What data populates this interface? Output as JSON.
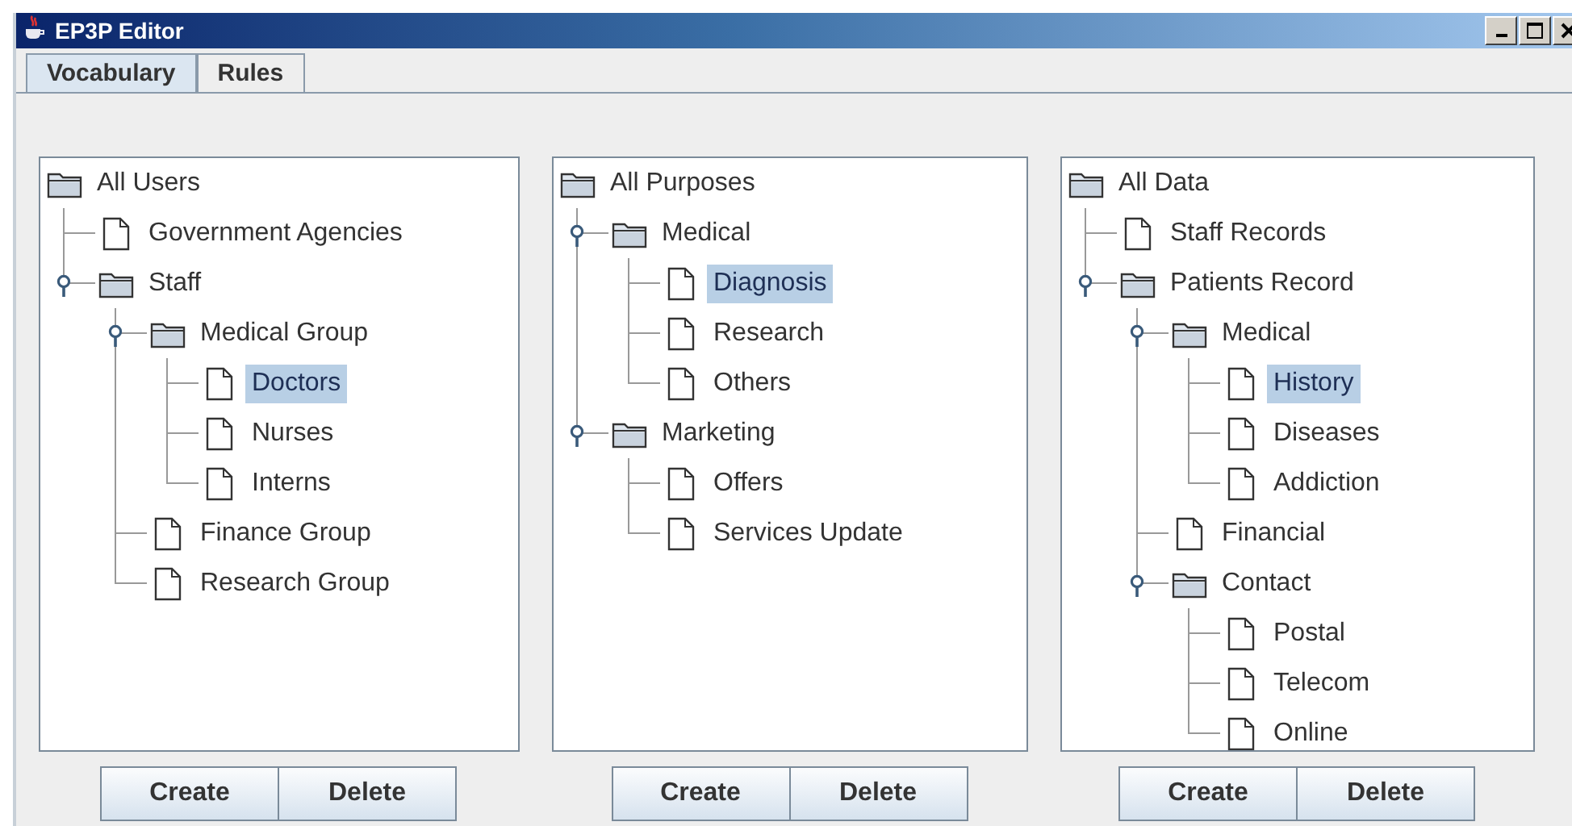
{
  "window": {
    "title": "EP3P Editor"
  },
  "tabs": [
    {
      "label": "Vocabulary",
      "selected": true
    },
    {
      "label": "Rules",
      "selected": false
    }
  ],
  "panels": [
    {
      "tree": {
        "label": "All Users",
        "children": [
          {
            "label": "Government Agencies",
            "kind": "file",
            "selected": false
          },
          {
            "label": "Staff",
            "kind": "folder",
            "expanded": true,
            "selected": false,
            "children": [
              {
                "label": "Medical Group",
                "kind": "folder",
                "expanded": true,
                "selected": false,
                "children": [
                  {
                    "label": "Doctors",
                    "kind": "file",
                    "selected": true
                  },
                  {
                    "label": "Nurses",
                    "kind": "file",
                    "selected": false
                  },
                  {
                    "label": "Interns",
                    "kind": "file",
                    "selected": false
                  }
                ]
              },
              {
                "label": "Finance Group",
                "kind": "file",
                "selected": false
              },
              {
                "label": "Research Group",
                "kind": "file",
                "selected": false
              }
            ]
          }
        ]
      },
      "buttons": [
        "Create",
        "Delete"
      ]
    },
    {
      "tree": {
        "label": "All Purposes",
        "children": [
          {
            "label": "Medical",
            "kind": "folder",
            "expanded": true,
            "selected": false,
            "children": [
              {
                "label": "Diagnosis",
                "kind": "file",
                "selected": true
              },
              {
                "label": "Research",
                "kind": "file",
                "selected": false
              },
              {
                "label": "Others",
                "kind": "file",
                "selected": false
              }
            ]
          },
          {
            "label": "Marketing",
            "kind": "folder",
            "expanded": true,
            "selected": false,
            "children": [
              {
                "label": "Offers",
                "kind": "file",
                "selected": false
              },
              {
                "label": "Services Update",
                "kind": "file",
                "selected": false
              }
            ]
          }
        ]
      },
      "buttons": [
        "Create",
        "Delete"
      ]
    },
    {
      "tree": {
        "label": "All Data",
        "children": [
          {
            "label": "Staff Records",
            "kind": "file",
            "selected": false
          },
          {
            "label": "Patients Record",
            "kind": "folder",
            "expanded": true,
            "selected": false,
            "children": [
              {
                "label": "Medical",
                "kind": "folder",
                "expanded": true,
                "selected": false,
                "children": [
                  {
                    "label": "History",
                    "kind": "file",
                    "selected": true
                  },
                  {
                    "label": "Diseases",
                    "kind": "file",
                    "selected": false
                  },
                  {
                    "label": "Addiction",
                    "kind": "file",
                    "selected": false
                  }
                ]
              },
              {
                "label": "Financial",
                "kind": "file",
                "selected": false
              },
              {
                "label": "Contact",
                "kind": "folder",
                "expanded": true,
                "selected": false,
                "children": [
                  {
                    "label": "Postal",
                    "kind": "file",
                    "selected": false
                  },
                  {
                    "label": "Telecom",
                    "kind": "file",
                    "selected": false
                  },
                  {
                    "label": "Online",
                    "kind": "file",
                    "selected": false
                  }
                ]
              }
            ]
          }
        ]
      },
      "buttons": [
        "Create",
        "Delete"
      ]
    }
  ]
}
